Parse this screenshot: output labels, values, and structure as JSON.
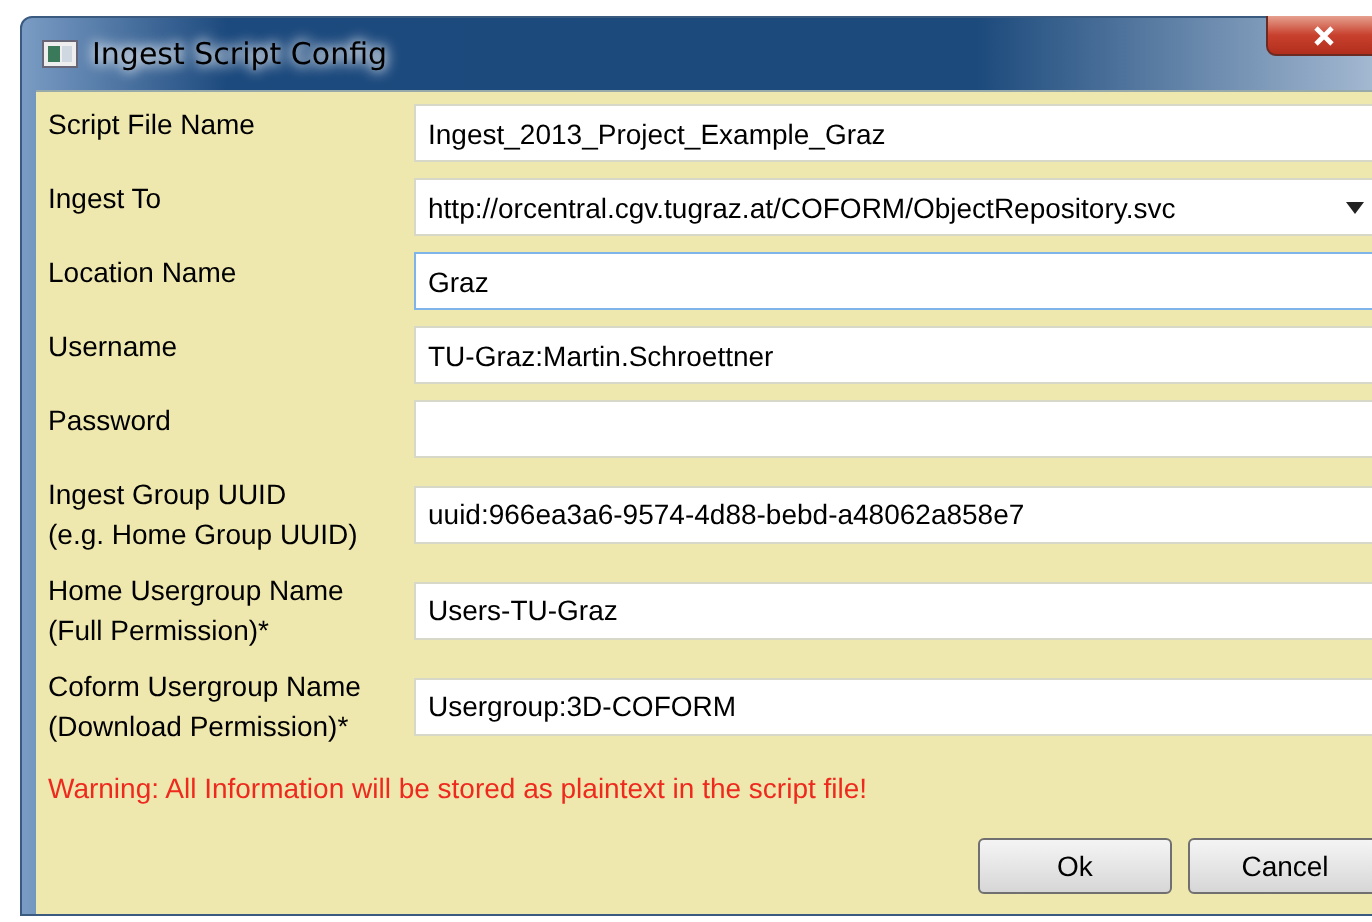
{
  "window": {
    "title": "Ingest Script Config"
  },
  "fields": [
    {
      "label": "Script File Name",
      "kind": "text",
      "value": "Ingest_2013_Project_Example_Graz",
      "focused": false
    },
    {
      "label": "Ingest To",
      "kind": "combo",
      "value": "http://orcentral.cgv.tugraz.at/COFORM/ObjectRepository.svc",
      "focused": false
    },
    {
      "label": "Location Name",
      "kind": "text",
      "value": "Graz",
      "focused": true
    },
    {
      "label": "Username",
      "kind": "text",
      "value": "TU-Graz:Martin.Schroettner",
      "focused": false
    },
    {
      "label": "Password",
      "kind": "text",
      "focused": false
    },
    {
      "label": "Ingest Group UUID\n(e.g. Home Group UUID)",
      "kind": "text",
      "value": "uuid:966ea3a6-9574-4d88-bebd-a48062a858e7",
      "focused": false
    },
    {
      "label": "Home Usergroup Name\n(Full Permission)*",
      "kind": "text",
      "value": "Users-TU-Graz",
      "focused": false
    },
    {
      "label": "Coform Usergroup Name\n(Download Permission)*",
      "kind": "text",
      "value": "Usergroup:3D-COFORM",
      "focused": false
    }
  ],
  "warning": "Warning: All Information will be stored as plaintext in the script file!",
  "buttons": [
    "Ok",
    "Cancel"
  ]
}
